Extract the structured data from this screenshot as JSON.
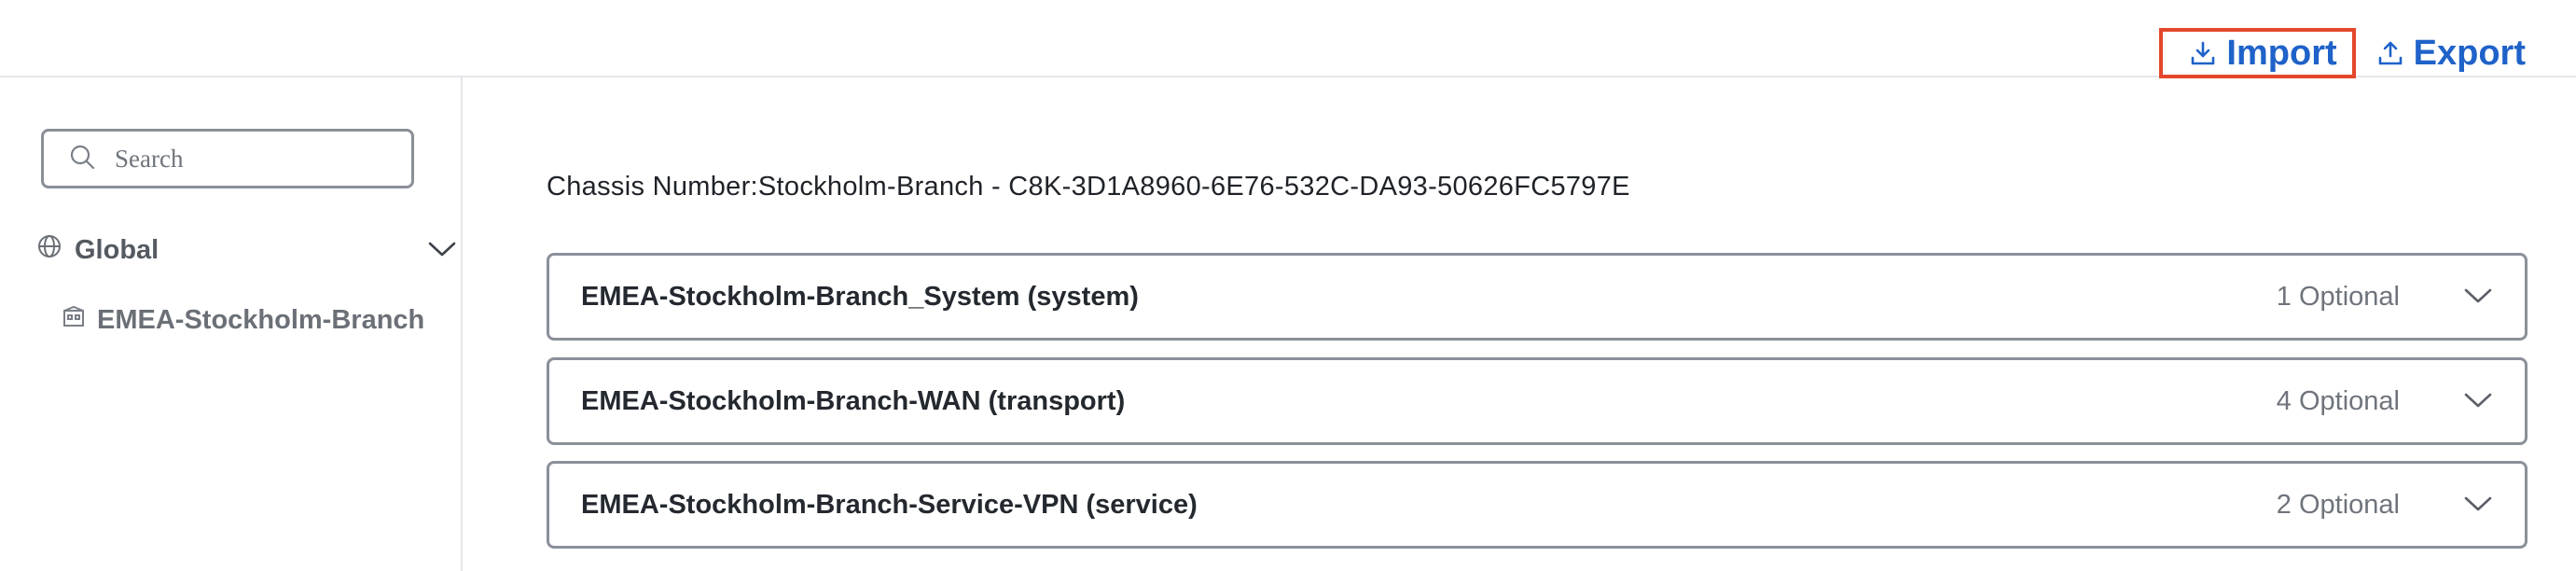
{
  "header": {
    "import_label": "Import",
    "export_label": "Export",
    "accent_color": "#1f62c9",
    "highlight_color": "#e4472c"
  },
  "sidebar": {
    "search": {
      "placeholder": "Search",
      "value": ""
    },
    "tree": {
      "root": {
        "label": "Global",
        "icon": "globe-icon"
      },
      "children": [
        {
          "label": "EMEA-Stockholm-Branch",
          "icon": "building-icon"
        }
      ]
    }
  },
  "main": {
    "chassis_label": "Chassis Number:Stockholm-Branch - C8K-3D1A8960-6E76-532C-DA93-50626FC5797E",
    "panels": [
      {
        "title": "EMEA-Stockholm-Branch_System (system)",
        "count": "1 Optional"
      },
      {
        "title": "EMEA-Stockholm-Branch-WAN (transport)",
        "count": "4 Optional"
      },
      {
        "title": "EMEA-Stockholm-Branch-Service-VPN (service)",
        "count": "2 Optional"
      }
    ]
  }
}
